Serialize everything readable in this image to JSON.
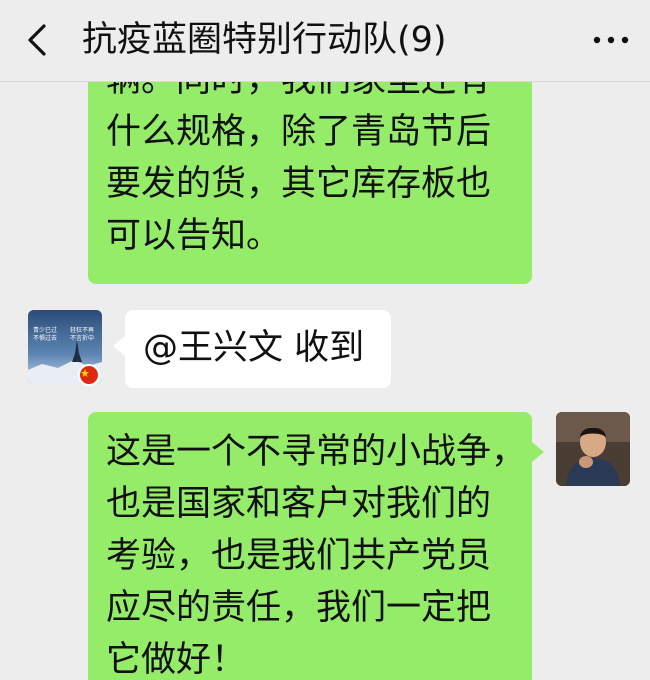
{
  "header": {
    "back_icon": "chevron-left-icon",
    "title": "抗疫蓝圈特别行动队(9)",
    "more_icon": "ellipsis-icon"
  },
  "messages": [
    {
      "side": "right",
      "bubble_color": "#95ec69",
      "lines": [
        "辆。同时，我们家里还有",
        "什么规格，除了青岛节后",
        "要发的货，其它库存板也",
        "可以告知。"
      ]
    },
    {
      "side": "left",
      "bubble_color": "#ffffff",
      "avatar": "landscape-avatar",
      "avatar_text": [
        "青少已过",
        "不惧过去",
        "轻狂不再",
        "不言折中"
      ],
      "flag": "china-flag-icon",
      "text": "@王兴文  收到"
    },
    {
      "side": "right",
      "bubble_color": "#95ec69",
      "avatar": "person-avatar",
      "lines": [
        "这是一个不寻常的小战争，",
        "也是国家和客户对我们的",
        "考验，也是我们共产党员",
        "应尽的责任，我们一定把",
        "它做好！"
      ]
    }
  ],
  "colors": {
    "background": "#ededed",
    "bubble_green": "#95ec69",
    "bubble_white": "#ffffff"
  }
}
